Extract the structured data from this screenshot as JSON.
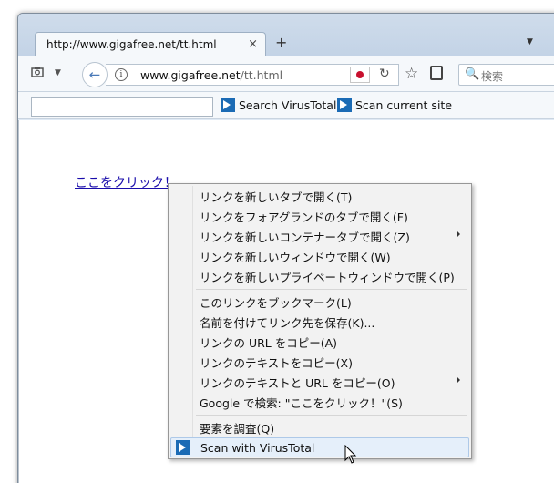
{
  "tab": {
    "title": "http://www.gigafree.net/tt.html",
    "close": "×"
  },
  "tabstrip": {
    "new_tab": "+",
    "menu": "▼"
  },
  "navbar": {
    "back": "←",
    "url_domain": "www.gigafree.net",
    "url_path": "/tt.html",
    "reload": "↻",
    "bookmark": "☆",
    "search_placeholder": "検索",
    "search_icon": "🔍"
  },
  "toolbar": {
    "input_value": "",
    "search_vt_label": "Search VirusTotal",
    "scan_site_label": "Scan current site"
  },
  "page": {
    "link_text": "ここをクリック！"
  },
  "context_menu": {
    "items": [
      {
        "label": "リンクを新しいタブで開く(T)",
        "submenu": false
      },
      {
        "label": "リンクをフォアグランドのタブで開く(F)",
        "submenu": false
      },
      {
        "label": "リンクを新しいコンテナータブで開く(Z)",
        "submenu": true
      },
      {
        "label": "リンクを新しいウィンドウで開く(W)",
        "submenu": false
      },
      {
        "label": "リンクを新しいプライベートウィンドウで開く(P)",
        "submenu": false
      },
      {
        "label": "このリンクをブックマーク(L)",
        "submenu": false
      },
      {
        "label": "名前を付けてリンク先を保存(K)...",
        "submenu": false
      },
      {
        "label": "リンクの URL をコピー(A)",
        "submenu": false
      },
      {
        "label": "リンクのテキストをコピー(X)",
        "submenu": false
      },
      {
        "label": "リンクのテキストと URL をコピー(O)",
        "submenu": true
      },
      {
        "label": "Google で検索: \"ここをクリック！\"(S)",
        "submenu": false
      },
      {
        "label": "要素を調査(Q)",
        "submenu": false
      },
      {
        "label": "Scan with VirusTotal",
        "submenu": false
      }
    ]
  },
  "colors": {
    "link": "#1a0dab",
    "vt_blue": "#1b6bb5",
    "hover": "#e5effa"
  }
}
